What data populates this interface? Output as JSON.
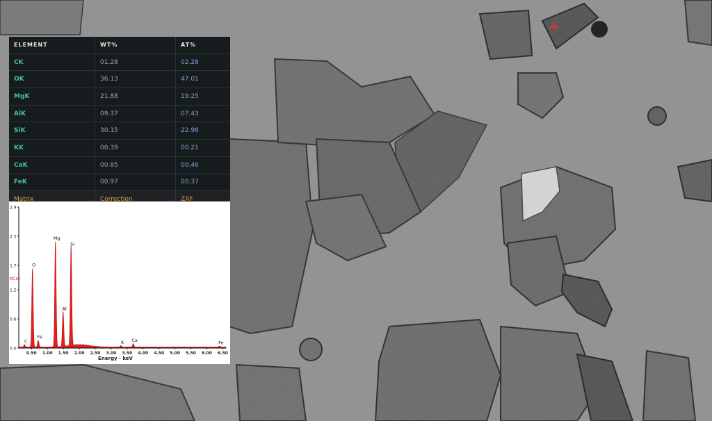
{
  "table": {
    "headers": [
      "ELEMENT",
      "WT%",
      "AT%"
    ],
    "rows": [
      {
        "element": "CK",
        "wt": "01.28",
        "at": "02.28"
      },
      {
        "element": "OK",
        "wt": "36.13",
        "at": "47.01"
      },
      {
        "element": "MgK",
        "wt": "21.88",
        "at": "19.25"
      },
      {
        "element": "AlK",
        "wt": "09.37",
        "at": "07.43"
      },
      {
        "element": "SiK",
        "wt": "30.15",
        "at": "22.98"
      },
      {
        "element": "KK",
        "wt": "00.39",
        "at": "00.21"
      },
      {
        "element": "CaK",
        "wt": "00.85",
        "at": "00.46"
      },
      {
        "element": "FeK",
        "wt": "00.97",
        "at": "00.37"
      }
    ],
    "footer": [
      "Matrix",
      "Correction",
      "ZAF"
    ]
  },
  "colors": {
    "element": "#47c29c",
    "wt": "#9aa7ad",
    "at": "#7ba1d6",
    "matrix": "#e09a3c",
    "spectrum": "#e02020"
  },
  "chart_data": {
    "type": "area",
    "xlabel": "Energy - keV",
    "ylabel": "KCnt",
    "xlim": [
      0.1,
      6.6
    ],
    "ylim": [
      0.0,
      2.9
    ],
    "xticks": [
      "0.50",
      "1.00",
      "1.50",
      "2.00",
      "2.50",
      "3.00",
      "3.50",
      "4.00",
      "4.50",
      "5.00",
      "5.50",
      "6.00",
      "6.50"
    ],
    "yticks": [
      "0.0",
      "0.6",
      "1.2",
      "1.7",
      "2.3",
      "2.9"
    ],
    "peaks": [
      {
        "label": "C",
        "x": 0.28,
        "y": 0.05
      },
      {
        "label": "O",
        "x": 0.53,
        "y": 1.62
      },
      {
        "label": "Fe",
        "x": 0.71,
        "y": 0.14
      },
      {
        "label": "Mg",
        "x": 1.25,
        "y": 2.17
      },
      {
        "label": "Al",
        "x": 1.49,
        "y": 0.72
      },
      {
        "label": "Si",
        "x": 1.74,
        "y": 2.05
      },
      {
        "label": "K",
        "x": 3.31,
        "y": 0.03
      },
      {
        "label": "Ca",
        "x": 3.69,
        "y": 0.07
      },
      {
        "label": "Fe",
        "x": 6.4,
        "y": 0.02
      }
    ]
  }
}
